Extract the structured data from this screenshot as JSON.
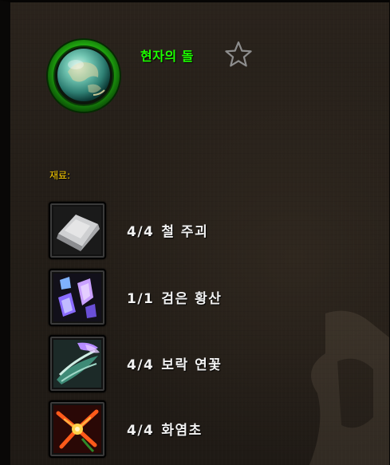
{
  "item": {
    "name": "현자의 돌",
    "name_color": "#1eff00",
    "icon": "philosophers-stone-orb-icon",
    "favorite_icon": "star-outline-icon"
  },
  "reagents": {
    "label": "재료:",
    "label_color": "#ffd100",
    "items": [
      {
        "quantity": "4/4",
        "name": "철 주괴",
        "icon": "iron-bar-icon"
      },
      {
        "quantity": "1/1",
        "name": "검은 황산",
        "icon": "black-vitriol-icon"
      },
      {
        "quantity": "4/4",
        "name": "보락 연꽃",
        "icon": "purple-lotus-icon"
      },
      {
        "quantity": "4/4",
        "name": "화염초",
        "icon": "firebloom-icon"
      }
    ]
  }
}
